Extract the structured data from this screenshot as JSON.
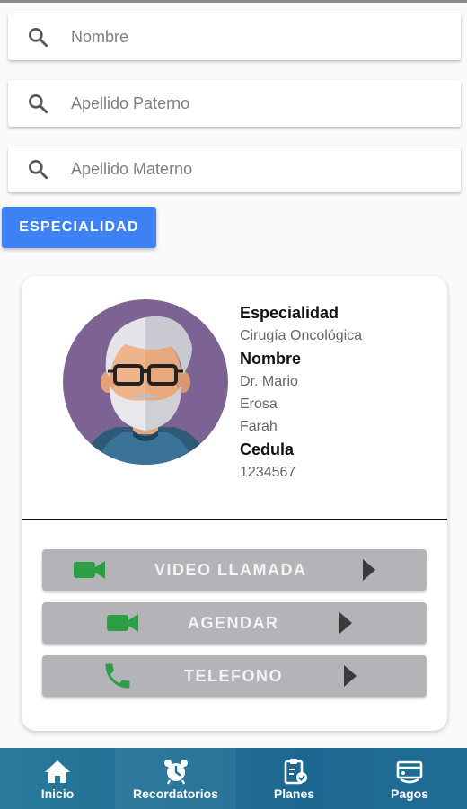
{
  "search": {
    "nombre_placeholder": "Nombre",
    "paterno_placeholder": "Apellido Paterno",
    "materno_placeholder": "Apellido Materno"
  },
  "specialty_button": "ESPECIALIDAD",
  "doctor": {
    "especialidad_label": "Especialidad",
    "especialidad_value": "Cirugía Oncológica",
    "nombre_label": "Nombre",
    "nombre_line1": "Dr. Mario",
    "nombre_line2": "Erosa",
    "nombre_line3": "Farah",
    "cedula_label": "Cedula",
    "cedula_value": "1234567"
  },
  "actions": {
    "video_label": "VIDEO LLAMADA",
    "agendar_label": "AGENDAR",
    "telefono_label": "TELEFONO"
  },
  "nav": {
    "inicio": "Inicio",
    "recordatorios": "Recordatorios",
    "planes": "Planes",
    "pagos": "Pagos"
  },
  "colors": {
    "primary_button": "#3d82f5",
    "action_icon_green": "#2e9e44",
    "nav_bar": "#1f6f95"
  },
  "icons": {
    "search": "search-icon",
    "video": "video-camera-icon",
    "phone": "phone-icon",
    "play": "play-arrow-icon",
    "inicio": "home-icon",
    "recordatorios": "alarm-clock-icon",
    "planes": "clipboard-check-icon",
    "pagos": "payment-icon"
  }
}
